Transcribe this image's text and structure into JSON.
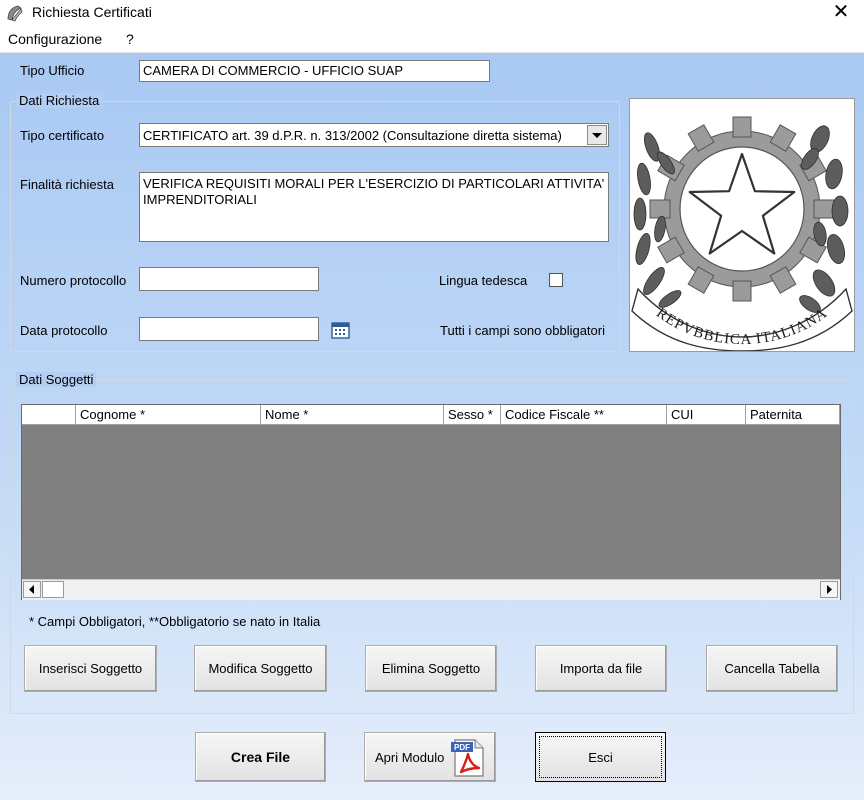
{
  "window": {
    "title": "Richiesta Certificati"
  },
  "menu": {
    "items": [
      "Configurazione",
      "?"
    ]
  },
  "form": {
    "tipo_ufficio_label": "Tipo Ufficio",
    "tipo_ufficio_value": "CAMERA DI COMMERCIO - UFFICIO SUAP",
    "dati_richiesta_title": "Dati Richiesta",
    "tipo_certificato_label": "Tipo certificato",
    "tipo_certificato_value": "CERTIFICATO art. 39 d.P.R. n. 313/2002 (Consultazione diretta sistema)",
    "finalita_label": "Finalità richiesta",
    "finalita_value": "VERIFICA REQUISITI MORALI PER L'ESERCIZIO DI PARTICOLARI ATTIVITA' IMPRENDITORIALI",
    "numero_protocollo_label": "Numero protocollo",
    "numero_protocollo_value": "",
    "lingua_tedesca_label": "Lingua tedesca",
    "lingua_tedesca_checked": false,
    "data_protocollo_label": "Data protocollo",
    "data_protocollo_value": "",
    "obbligatori_note": "Tutti i campi sono obbligatori"
  },
  "emblem": {
    "lettering": "REPVBBLICA ITALIANA"
  },
  "soggetti": {
    "title": "Dati Soggetti",
    "columns": [
      "",
      "Cognome *",
      "Nome *",
      "Sesso *",
      "Codice Fiscale **",
      "CUI",
      "Paternita"
    ],
    "rows": [],
    "note": "* Campi Obbligatori, **Obbligatorio se nato in Italia",
    "buttons": {
      "inserisci": "Inserisci Soggetto",
      "modifica": "Modifica Soggetto",
      "elimina": "Elimina Soggetto",
      "importa": "Importa da file",
      "cancella": "Cancella Tabella"
    }
  },
  "footer": {
    "crea_file": "Crea File",
    "apri_modulo": "Apri Modulo",
    "esci": "Esci",
    "pdf_icon_text": "PDF"
  }
}
